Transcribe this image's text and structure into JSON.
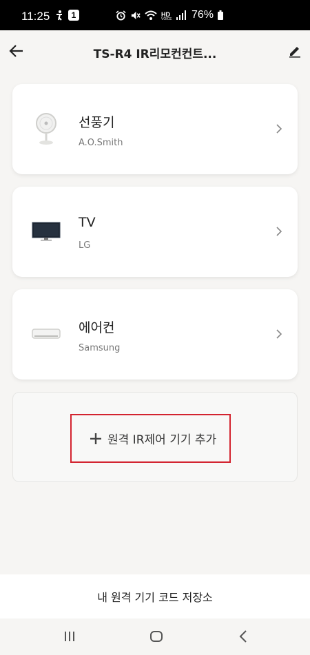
{
  "status_bar": {
    "time": "11:25",
    "notification_badge": "1",
    "battery": "76%",
    "icons": [
      "accessibility-icon",
      "alarm-icon",
      "mute-icon",
      "wifi-icon",
      "hd-voice-icon",
      "signal-icon",
      "battery-icon"
    ]
  },
  "header": {
    "title": "TS-R4 IR리모컨컨트...",
    "back_icon": "back-arrow-icon",
    "edit_icon": "edit-pencil-icon"
  },
  "devices": [
    {
      "name": "선풍기",
      "brand": "A.O.Smith",
      "icon": "fan-icon"
    },
    {
      "name": "TV",
      "brand": "LG",
      "icon": "tv-icon"
    },
    {
      "name": "에어컨",
      "brand": "Samsung",
      "icon": "air-conditioner-icon"
    }
  ],
  "add_device": {
    "label": "원격 IR제어 기기 추가",
    "highlight_color": "#d3232f"
  },
  "bottom_bar": {
    "label": "내 원격 기기 코드 저장소"
  },
  "nav": [
    "recent-apps-icon",
    "home-icon",
    "back-icon"
  ]
}
